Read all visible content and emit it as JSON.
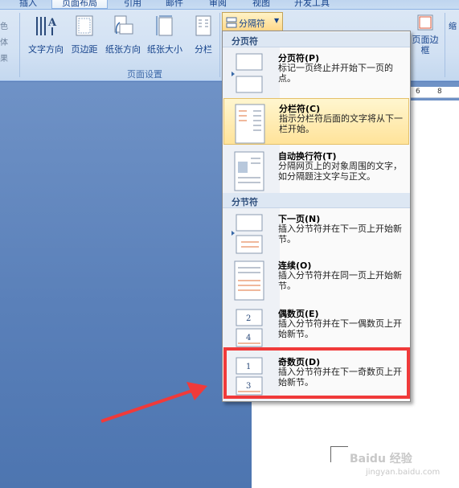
{
  "tabs": [
    "插入",
    "页面布局",
    "引用",
    "邮件",
    "审阅",
    "视图",
    "开发工具"
  ],
  "ribbon": {
    "buttons": {
      "text_direction": "文字方向",
      "margins": "页边距",
      "orientation": "纸张方向",
      "size": "纸张大小",
      "columns": "分栏",
      "page_borders": "页面边框"
    },
    "group_page_setup": "页面设置",
    "side_glyphs": [
      "色",
      "体",
      "果"
    ],
    "right_glyph": "缩"
  },
  "breaks_button": "分隔符",
  "menu": {
    "section_page": "分页符",
    "section_section": "分节符",
    "items": [
      {
        "title": "分页符(P)",
        "desc": "标记一页终止并开始下一页的点。"
      },
      {
        "title": "分栏符(C)",
        "desc": "指示分栏符后面的文字将从下一栏开始。"
      },
      {
        "title": "自动换行符(T)",
        "desc": "分隔网页上的对象周围的文字，如分隔题注文字与正文。"
      },
      {
        "title": "下一页(N)",
        "desc": "插入分节符并在下一页上开始新节。"
      },
      {
        "title": "连续(O)",
        "desc": "插入分节符并在同一页上开始新节。"
      },
      {
        "title": "偶数页(E)",
        "desc": "插入分节符并在下一偶数页上开始新节。"
      },
      {
        "title": "奇数页(D)",
        "desc": "插入分节符并在下一奇数页上开始新节。"
      }
    ]
  },
  "ruler": [
    "6",
    "8"
  ],
  "watermark": {
    "main": "Baidu 经验",
    "sub": "jingyan.baidu.com"
  },
  "colors": {
    "highlight": "#ffe39a",
    "annotation": "#f03a3a",
    "ribbon": "#d2e1f3"
  }
}
